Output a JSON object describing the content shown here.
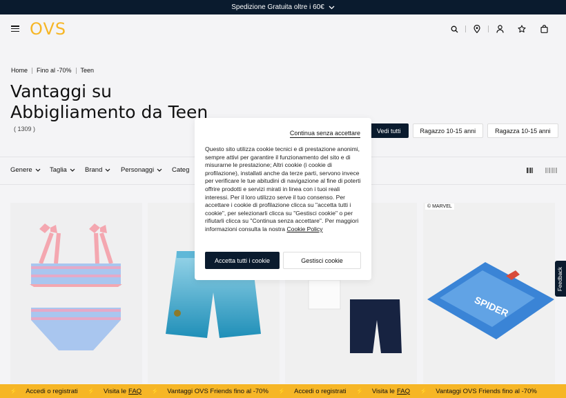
{
  "promo_bar": {
    "text": "Spedizione Gratuita oltre i 60€"
  },
  "header": {
    "logo": "OVS",
    "icons": [
      "search-icon",
      "location-icon",
      "user-icon",
      "star-icon",
      "bag-icon"
    ]
  },
  "breadcrumb": [
    "Home",
    "Fino al -70%",
    "Teen"
  ],
  "page": {
    "title": "Vantaggi su Abbigliamento da Teen",
    "count": "( 1309 )"
  },
  "chips": [
    "Vedi tutti",
    "Ragazzo 10-15 anni",
    "Ragazza 10-15 anni"
  ],
  "filters": [
    "Genere",
    "Taglia",
    "Brand",
    "Personaggi",
    "Categ"
  ],
  "products": [
    {
      "name": "bikini-rosa-azzurro",
      "badge": ""
    },
    {
      "name": "costume-boxer-azzurro",
      "badge": ""
    },
    {
      "name": "canotta-shorts-blu",
      "badge": ""
    },
    {
      "name": "telo-spiderman",
      "badge": "© MARVEL",
      "print": "SPIDER"
    }
  ],
  "ticker": {
    "items": [
      {
        "text": "Accedi o registrati"
      },
      {
        "text": "Visita le",
        "link": "FAQ"
      },
      {
        "text": "Vantaggi OVS Friends fino al -70%"
      },
      {
        "text": "Accedi o registrati"
      },
      {
        "text": "Visita le",
        "link": "FAQ"
      },
      {
        "text": "Vantaggi OVS Friends fino al -70%"
      }
    ]
  },
  "feedback": "Feedback",
  "cookie": {
    "skip": "Continua senza accettare",
    "text": "Questo sito utilizza cookie tecnici e di prestazione anonimi, sempre attivi per garantire il funzionamento del sito e di misurarne le prestazione; Altri cookie (i cookie di profilazione), installati anche da terze parti, servono invece per verificare le tue abitudini di navigazione al fine di poterti offrire prodotti e servizi mirati in linea con i tuoi reali interessi. Per il loro utilizzo serve il tuo consenso. Per accettare i cookie di profilazione clicca su \"accetta tutti i cookie\", per selezionarli clicca su \"Gestisci cookie\" o per rifiutarli clicca su \"Continua senza accettare\". Per maggiori informazioni consulta la nostra",
    "policy_link": "Cookie Policy",
    "accept": "Accetta tutti i cookie",
    "manage": "Gestisci cookie"
  },
  "colors": {
    "navy": "#0a1b2e",
    "yellow": "#f6b626"
  }
}
